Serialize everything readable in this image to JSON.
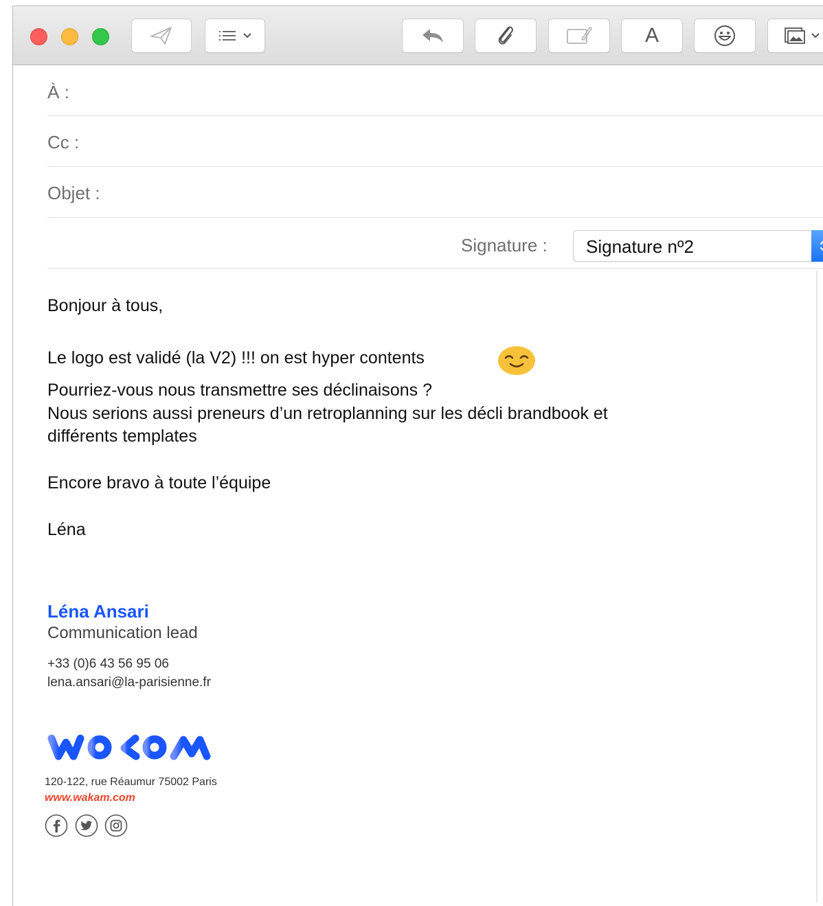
{
  "window": {
    "traffic_lights": [
      "close",
      "minimize",
      "zoom"
    ],
    "toolbar_icons": [
      "send-icon",
      "header-fields-menu-icon",
      "reply-icon",
      "attachment-icon",
      "markup-icon",
      "font-icon",
      "emoji-icon",
      "photo-browser-icon"
    ],
    "font_button_label": "A"
  },
  "fields": {
    "to_label": "À :",
    "cc_label": "Cc :",
    "subject_label": "Objet :",
    "signature_label": "Signature :",
    "signature_value": "Signature nº2"
  },
  "message": {
    "greeting": "Bonjour à tous,",
    "line1": "Le logo est validé (la V2) !!! on est hyper contents",
    "line2": "Pourriez-vous nous transmettre ses déclinaisons ?",
    "line3a": "Nous serions aussi preneurs d’un retroplanning sur les décli brandbook et",
    "line3b": "différents templates",
    "closing": "Encore bravo à toute l’équipe",
    "sign_off": "Léna",
    "emoji": "smiling-face-icon"
  },
  "signature": {
    "name": "Léna Ansari",
    "role": "Communication lead",
    "phone": "+33 (0)6 43 56 95 06",
    "email": "lena.ansari@la-parisienne.fr",
    "logo_text": "wakam",
    "address": "120-122, rue Réaumur 75002 Paris",
    "website": "www.wakam.com",
    "social_icons": [
      "facebook-icon",
      "twitter-icon",
      "instagram-icon"
    ]
  },
  "colors": {
    "brand_blue": "#1a56ff",
    "link_red": "#e8462e",
    "stepper_blue": "#1b72f0"
  }
}
